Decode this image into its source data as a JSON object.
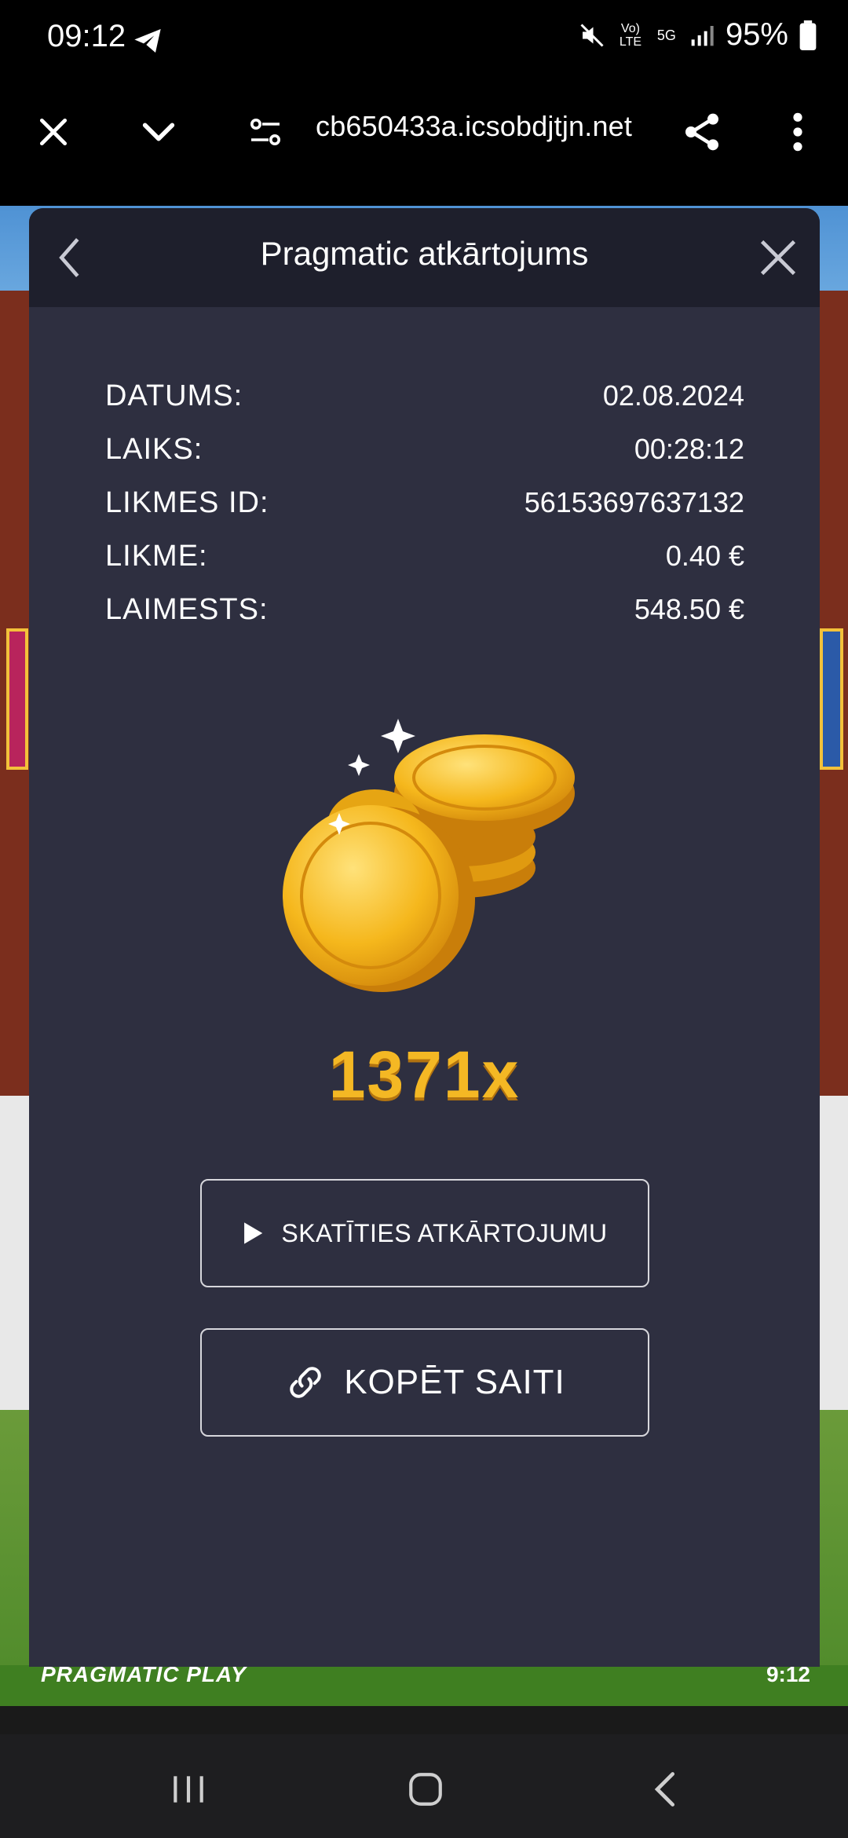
{
  "status_bar": {
    "time": "09:12",
    "battery_percent": "95%",
    "network_lte": "Vo) LTE",
    "network_5g": "5G",
    "icons": [
      "telegram-icon",
      "mute-icon",
      "signal-icon",
      "battery-icon"
    ]
  },
  "browser": {
    "url": "cb650433a.icsobdjtjn.net",
    "buttons": [
      "close-icon",
      "chevron-down-icon",
      "site-settings-icon",
      "share-icon",
      "more-icon"
    ]
  },
  "game": {
    "brand": "PRAGMATIC PLAY",
    "clock": "9:12"
  },
  "modal": {
    "title": "Pragmatic atkārtojums",
    "details": [
      {
        "label": "DATUMS:",
        "value": "02.08.2024"
      },
      {
        "label": "LAIKS:",
        "value": "00:28:12"
      },
      {
        "label": "LIKMES ID:",
        "value": "56153697637132"
      },
      {
        "label": "LIKME:",
        "value": "0.40 €"
      },
      {
        "label": "LAIMESTS:",
        "value": "548.50 €"
      }
    ],
    "multiplier": "1371x",
    "replay_button": "SKATĪTIES ATKĀRTOJUMU",
    "copy_button": "KOPĒT SAITI"
  },
  "colors": {
    "modal_bg": "#2e2f40",
    "header_bg": "#1e1f2c",
    "multiplier": "#f4b824"
  }
}
